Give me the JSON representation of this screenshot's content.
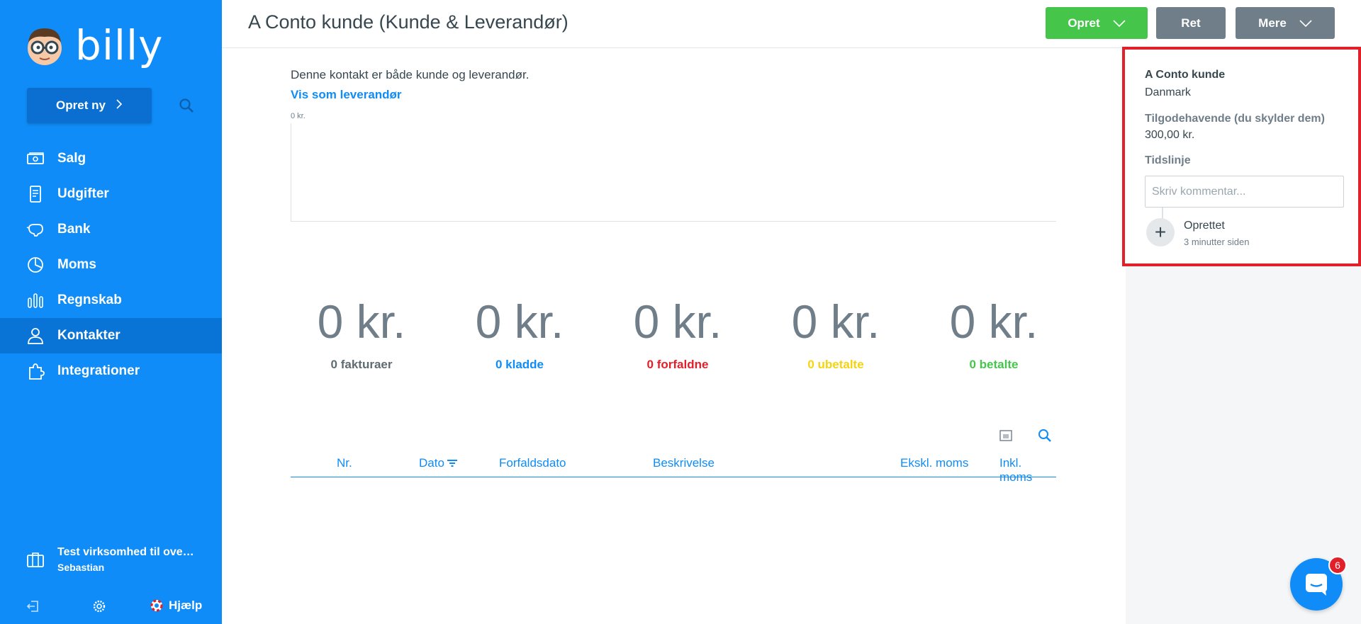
{
  "app": {
    "logo_text": "billy"
  },
  "sidebar": {
    "create_label": "Opret ny",
    "items": [
      {
        "label": "Salg",
        "icon": "money-icon"
      },
      {
        "label": "Udgifter",
        "icon": "receipt-icon"
      },
      {
        "label": "Bank",
        "icon": "piggybank-icon"
      },
      {
        "label": "Moms",
        "icon": "piechart-icon"
      },
      {
        "label": "Regnskab",
        "icon": "barchart-icon"
      },
      {
        "label": "Kontakter",
        "icon": "user-icon",
        "active": true
      },
      {
        "label": "Integrationer",
        "icon": "puzzle-icon"
      }
    ],
    "company": {
      "name": "Test virksomhed til ove…",
      "user": "Sebastian"
    },
    "help_label": "Hjælp"
  },
  "header": {
    "title": "A Conto kunde (Kunde & Leverandør)",
    "buttons": {
      "create": "Opret",
      "edit": "Ret",
      "more": "Mere"
    }
  },
  "main": {
    "description": "Denne kontakt er både kunde og leverandør.",
    "show_supplier_link": "Vis som leverandør",
    "chart_ylabel": "0 kr.",
    "stats": [
      {
        "amount": "0 kr.",
        "label": "0 fakturaer",
        "color": "#5f6b73"
      },
      {
        "amount": "0 kr.",
        "label": "0 kladde",
        "color": "#0f8cf7"
      },
      {
        "amount": "0 kr.",
        "label": "0 forfaldne",
        "color": "#e2202a"
      },
      {
        "amount": "0 kr.",
        "label": "0 ubetalte",
        "color": "#f5d40f"
      },
      {
        "amount": "0 kr.",
        "label": "0 betalte",
        "color": "#45c64a"
      }
    ],
    "table_columns": [
      "Nr.",
      "Dato",
      "Forfaldsdato",
      "Beskrivelse",
      "Ekskl. moms",
      "Inkl. moms"
    ]
  },
  "panel": {
    "name": "A Conto kunde",
    "country": "Danmark",
    "balance_label": "Tilgodehavende (du skylder dem)",
    "balance": "300,00 kr.",
    "timeline_label": "Tidslinje",
    "comment_placeholder": "Skriv kommentar...",
    "event": {
      "title": "Oprettet",
      "time": "3 minutter siden"
    }
  },
  "chat": {
    "badge": "6"
  },
  "colors": {
    "brand": "#0f8cf7",
    "success": "#45c64a",
    "neutral_button": "#6f7e88",
    "highlight": "#e2202a"
  }
}
